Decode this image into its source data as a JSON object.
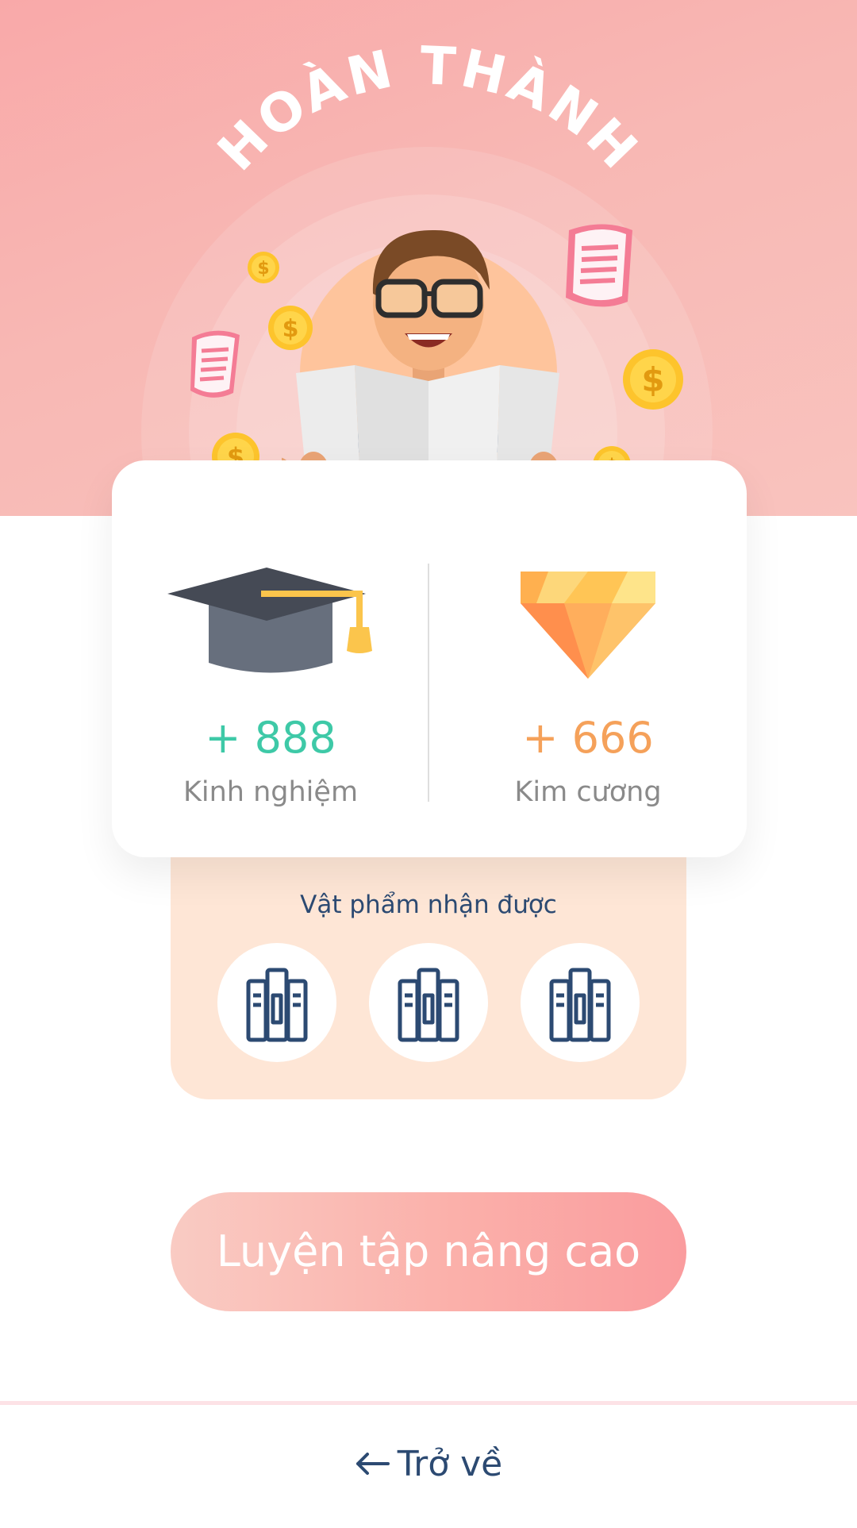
{
  "header": {
    "title": "HOÀN THÀNH"
  },
  "stats": {
    "experience": {
      "value": "+ 888",
      "label": "Kinh nghiệm",
      "icon": "graduation-cap-icon",
      "color": "#3ec9a7"
    },
    "diamond": {
      "value": "+ 666",
      "label": "Kim cương",
      "icon": "diamond-icon",
      "color": "#f5a15a"
    }
  },
  "items": {
    "title": "Vật phẩm nhận được",
    "list": [
      {
        "icon": "books-icon"
      },
      {
        "icon": "books-icon"
      },
      {
        "icon": "books-icon"
      }
    ]
  },
  "actions": {
    "primary_label": "Luyện tập nâng cao",
    "back_label": "Trở về"
  },
  "colors": {
    "hero_background": "#f9b4b0",
    "primary_button": "#fba7a6",
    "navy_text": "#2c4a72",
    "items_panel": "#fee6d6"
  }
}
